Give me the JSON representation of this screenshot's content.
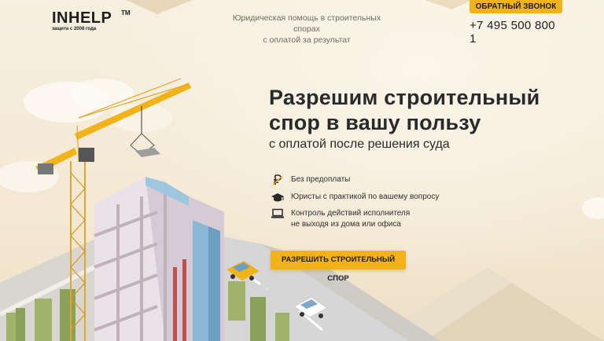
{
  "logo": {
    "name": "INHELP",
    "tm": "TM",
    "since": "защита с 2008 года"
  },
  "header": {
    "tagline_line1": "Юридическая помощь в строительных спорах",
    "tagline_line2": "с оплатой за результат",
    "callback_label": "ОБРАТНЫЙ ЗВОНОК",
    "phone": "+7 495 500 800 1"
  },
  "hero": {
    "title_line1": "Разрешим строительный",
    "title_line2": "спор в вашу пользу",
    "subtitle": "с оплатой после решения суда",
    "features": [
      {
        "icon": "ruble-icon",
        "line1": "Без предоплаты",
        "line2": ""
      },
      {
        "icon": "graduation-cap-icon",
        "line1": "Юристы с практикой по вашему вопросу",
        "line2": ""
      },
      {
        "icon": "laptop-icon",
        "line1": "Контроль действий исполнителя",
        "line2": "не выходя из дома или офиса"
      }
    ],
    "cta_label": "РАЗРЕШИТЬ СТРОИТЕЛЬНЫЙ СПОР"
  },
  "colors": {
    "accent": "#f2b31a",
    "background": "#f8f1e2",
    "text": "#2a2a2a"
  }
}
